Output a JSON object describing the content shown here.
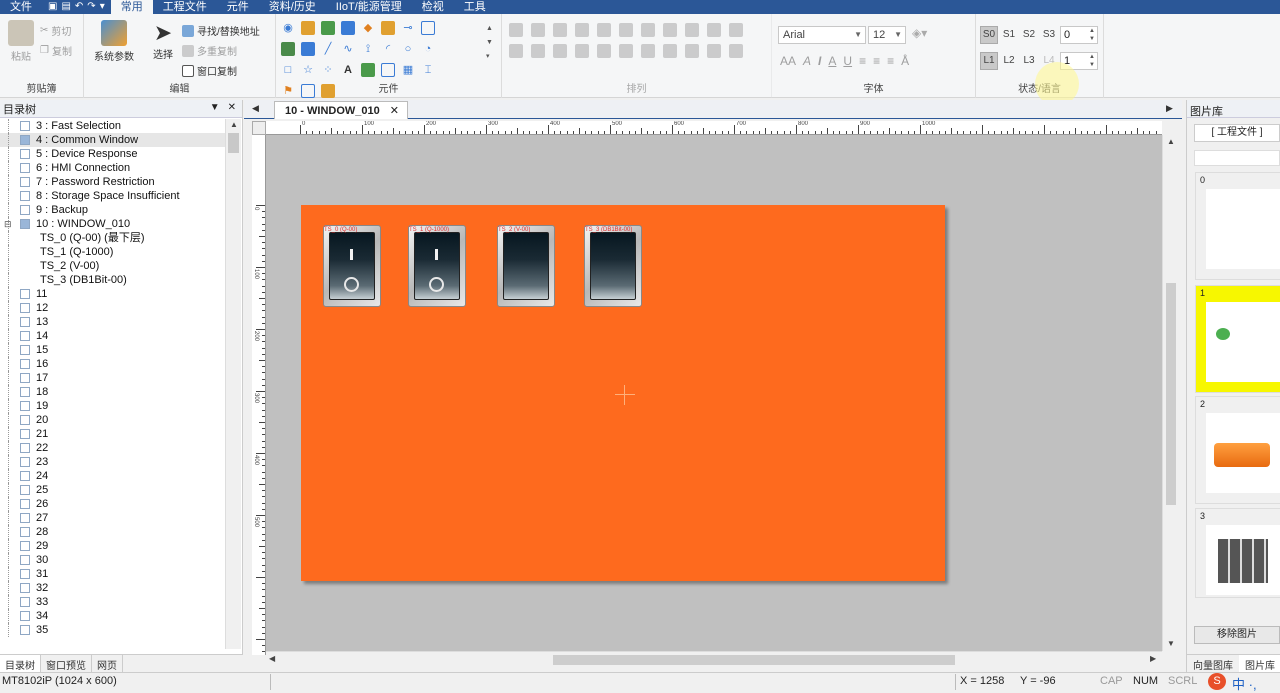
{
  "menubar": {
    "items": [
      "文件",
      "常用",
      "工程文件",
      "元件",
      "资料/历史",
      "IIoT/能源管理",
      "检视",
      "工具"
    ],
    "active": "常用"
  },
  "ribbon": {
    "clipboard": {
      "paste": "粘贴",
      "cut": "剪切",
      "copy": "复制",
      "label": "剪贴簿"
    },
    "edit": {
      "sysparam": "系统参数",
      "select": "选择",
      "find_replace": "寻找/替换地址",
      "multi_copy": "多重复制",
      "window_copy": "窗口复制",
      "label": "编辑"
    },
    "elements": {
      "label": "元件"
    },
    "arrange": {
      "label": "排列"
    },
    "font": {
      "name": "Arial",
      "size": "12",
      "label": "字体"
    },
    "state": {
      "s_buttons": [
        "S0",
        "S1",
        "S2",
        "S3"
      ],
      "s_value": "0",
      "l_buttons": [
        "L1",
        "L2",
        "L3",
        "L4"
      ],
      "l_value": "1",
      "label": "状态/语言"
    }
  },
  "leftpane": {
    "title": "目录树",
    "tree": [
      "3 : Fast Selection",
      "4 : Common Window",
      "5 : Device Response",
      "6 : HMI Connection",
      "7 : Password Restriction",
      "8 : Storage Space Insufficient",
      "9 : Backup",
      "10 : WINDOW_010",
      "TS_0 (Q-00) (最下层)",
      "TS_1 (Q-1000)",
      "TS_2 (V-00)",
      "TS_3 (DB1Bit-00)",
      "11",
      "12",
      "13",
      "14",
      "15",
      "16",
      "17",
      "18",
      "19",
      "20",
      "21",
      "22",
      "23",
      "24",
      "25",
      "26",
      "27",
      "28",
      "29",
      "30",
      "31",
      "32",
      "33",
      "34",
      "35"
    ],
    "tabs": [
      "目录树",
      "窗口预览",
      "网页"
    ]
  },
  "document": {
    "tab_title": "10 - WINDOW_010",
    "close": "✕"
  },
  "ruler": {
    "h_labels": [
      "0",
      "100",
      "200",
      "300",
      "400",
      "500",
      "600",
      "700",
      "800",
      "900",
      "1000"
    ],
    "v_labels": [
      "0",
      "100",
      "200",
      "300",
      "400",
      "500"
    ]
  },
  "canvas": {
    "switches": [
      {
        "label": "TS_0 (Q-00)",
        "type": "on"
      },
      {
        "label": "TS_1 (Q-1000)",
        "type": "on"
      },
      {
        "label": "TS_2 (V-00)",
        "type": "off"
      },
      {
        "label": "TS_3 (DB1Bit-00)",
        "type": "off"
      }
    ]
  },
  "rightpane": {
    "title": "图片库",
    "project_btn": "[ 工程文件 ]",
    "thumbs": [
      "0",
      "1",
      "2",
      "3"
    ],
    "remove_btn": "移除图片",
    "tabs": [
      "向量图库",
      "图片库"
    ]
  },
  "statusbar": {
    "model": "MT8102iP (1024 x 600)",
    "x": "X = 1258",
    "y": "Y = -96",
    "cap": "CAP",
    "num": "NUM",
    "scrl": "SCRL"
  },
  "colors": {
    "accent": "#2b5797",
    "window_bg": "#fe6a1e",
    "canvas_bg": "#c0c0c0",
    "selected_thumb": "#f7f700"
  }
}
